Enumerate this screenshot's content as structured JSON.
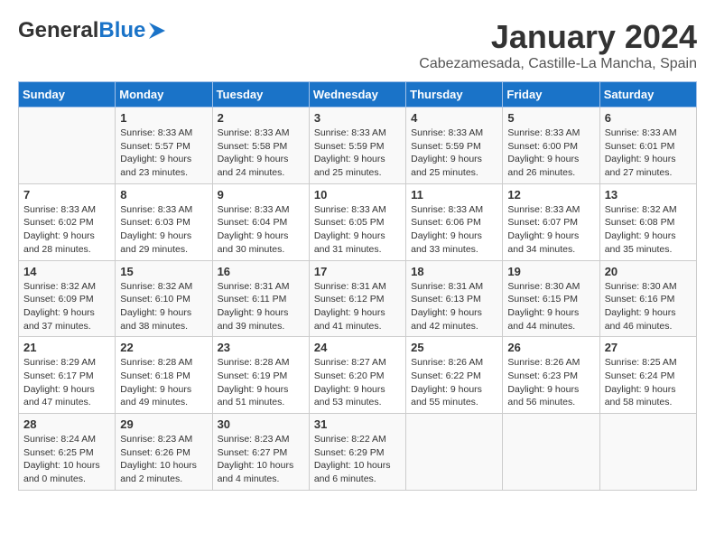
{
  "header": {
    "logo_general": "General",
    "logo_blue": "Blue",
    "month_title": "January 2024",
    "location": "Cabezamesada, Castille-La Mancha, Spain"
  },
  "days_of_week": [
    "Sunday",
    "Monday",
    "Tuesday",
    "Wednesday",
    "Thursday",
    "Friday",
    "Saturday"
  ],
  "weeks": [
    [
      {
        "day": "",
        "sunrise": "",
        "sunset": "",
        "daylight": ""
      },
      {
        "day": "1",
        "sunrise": "Sunrise: 8:33 AM",
        "sunset": "Sunset: 5:57 PM",
        "daylight": "Daylight: 9 hours and 23 minutes."
      },
      {
        "day": "2",
        "sunrise": "Sunrise: 8:33 AM",
        "sunset": "Sunset: 5:58 PM",
        "daylight": "Daylight: 9 hours and 24 minutes."
      },
      {
        "day": "3",
        "sunrise": "Sunrise: 8:33 AM",
        "sunset": "Sunset: 5:59 PM",
        "daylight": "Daylight: 9 hours and 25 minutes."
      },
      {
        "day": "4",
        "sunrise": "Sunrise: 8:33 AM",
        "sunset": "Sunset: 5:59 PM",
        "daylight": "Daylight: 9 hours and 25 minutes."
      },
      {
        "day": "5",
        "sunrise": "Sunrise: 8:33 AM",
        "sunset": "Sunset: 6:00 PM",
        "daylight": "Daylight: 9 hours and 26 minutes."
      },
      {
        "day": "6",
        "sunrise": "Sunrise: 8:33 AM",
        "sunset": "Sunset: 6:01 PM",
        "daylight": "Daylight: 9 hours and 27 minutes."
      }
    ],
    [
      {
        "day": "7",
        "sunrise": "Sunrise: 8:33 AM",
        "sunset": "Sunset: 6:02 PM",
        "daylight": "Daylight: 9 hours and 28 minutes."
      },
      {
        "day": "8",
        "sunrise": "Sunrise: 8:33 AM",
        "sunset": "Sunset: 6:03 PM",
        "daylight": "Daylight: 9 hours and 29 minutes."
      },
      {
        "day": "9",
        "sunrise": "Sunrise: 8:33 AM",
        "sunset": "Sunset: 6:04 PM",
        "daylight": "Daylight: 9 hours and 30 minutes."
      },
      {
        "day": "10",
        "sunrise": "Sunrise: 8:33 AM",
        "sunset": "Sunset: 6:05 PM",
        "daylight": "Daylight: 9 hours and 31 minutes."
      },
      {
        "day": "11",
        "sunrise": "Sunrise: 8:33 AM",
        "sunset": "Sunset: 6:06 PM",
        "daylight": "Daylight: 9 hours and 33 minutes."
      },
      {
        "day": "12",
        "sunrise": "Sunrise: 8:33 AM",
        "sunset": "Sunset: 6:07 PM",
        "daylight": "Daylight: 9 hours and 34 minutes."
      },
      {
        "day": "13",
        "sunrise": "Sunrise: 8:32 AM",
        "sunset": "Sunset: 6:08 PM",
        "daylight": "Daylight: 9 hours and 35 minutes."
      }
    ],
    [
      {
        "day": "14",
        "sunrise": "Sunrise: 8:32 AM",
        "sunset": "Sunset: 6:09 PM",
        "daylight": "Daylight: 9 hours and 37 minutes."
      },
      {
        "day": "15",
        "sunrise": "Sunrise: 8:32 AM",
        "sunset": "Sunset: 6:10 PM",
        "daylight": "Daylight: 9 hours and 38 minutes."
      },
      {
        "day": "16",
        "sunrise": "Sunrise: 8:31 AM",
        "sunset": "Sunset: 6:11 PM",
        "daylight": "Daylight: 9 hours and 39 minutes."
      },
      {
        "day": "17",
        "sunrise": "Sunrise: 8:31 AM",
        "sunset": "Sunset: 6:12 PM",
        "daylight": "Daylight: 9 hours and 41 minutes."
      },
      {
        "day": "18",
        "sunrise": "Sunrise: 8:31 AM",
        "sunset": "Sunset: 6:13 PM",
        "daylight": "Daylight: 9 hours and 42 minutes."
      },
      {
        "day": "19",
        "sunrise": "Sunrise: 8:30 AM",
        "sunset": "Sunset: 6:15 PM",
        "daylight": "Daylight: 9 hours and 44 minutes."
      },
      {
        "day": "20",
        "sunrise": "Sunrise: 8:30 AM",
        "sunset": "Sunset: 6:16 PM",
        "daylight": "Daylight: 9 hours and 46 minutes."
      }
    ],
    [
      {
        "day": "21",
        "sunrise": "Sunrise: 8:29 AM",
        "sunset": "Sunset: 6:17 PM",
        "daylight": "Daylight: 9 hours and 47 minutes."
      },
      {
        "day": "22",
        "sunrise": "Sunrise: 8:28 AM",
        "sunset": "Sunset: 6:18 PM",
        "daylight": "Daylight: 9 hours and 49 minutes."
      },
      {
        "day": "23",
        "sunrise": "Sunrise: 8:28 AM",
        "sunset": "Sunset: 6:19 PM",
        "daylight": "Daylight: 9 hours and 51 minutes."
      },
      {
        "day": "24",
        "sunrise": "Sunrise: 8:27 AM",
        "sunset": "Sunset: 6:20 PM",
        "daylight": "Daylight: 9 hours and 53 minutes."
      },
      {
        "day": "25",
        "sunrise": "Sunrise: 8:26 AM",
        "sunset": "Sunset: 6:22 PM",
        "daylight": "Daylight: 9 hours and 55 minutes."
      },
      {
        "day": "26",
        "sunrise": "Sunrise: 8:26 AM",
        "sunset": "Sunset: 6:23 PM",
        "daylight": "Daylight: 9 hours and 56 minutes."
      },
      {
        "day": "27",
        "sunrise": "Sunrise: 8:25 AM",
        "sunset": "Sunset: 6:24 PM",
        "daylight": "Daylight: 9 hours and 58 minutes."
      }
    ],
    [
      {
        "day": "28",
        "sunrise": "Sunrise: 8:24 AM",
        "sunset": "Sunset: 6:25 PM",
        "daylight": "Daylight: 10 hours and 0 minutes."
      },
      {
        "day": "29",
        "sunrise": "Sunrise: 8:23 AM",
        "sunset": "Sunset: 6:26 PM",
        "daylight": "Daylight: 10 hours and 2 minutes."
      },
      {
        "day": "30",
        "sunrise": "Sunrise: 8:23 AM",
        "sunset": "Sunset: 6:27 PM",
        "daylight": "Daylight: 10 hours and 4 minutes."
      },
      {
        "day": "31",
        "sunrise": "Sunrise: 8:22 AM",
        "sunset": "Sunset: 6:29 PM",
        "daylight": "Daylight: 10 hours and 6 minutes."
      },
      {
        "day": "",
        "sunrise": "",
        "sunset": "",
        "daylight": ""
      },
      {
        "day": "",
        "sunrise": "",
        "sunset": "",
        "daylight": ""
      },
      {
        "day": "",
        "sunrise": "",
        "sunset": "",
        "daylight": ""
      }
    ]
  ]
}
